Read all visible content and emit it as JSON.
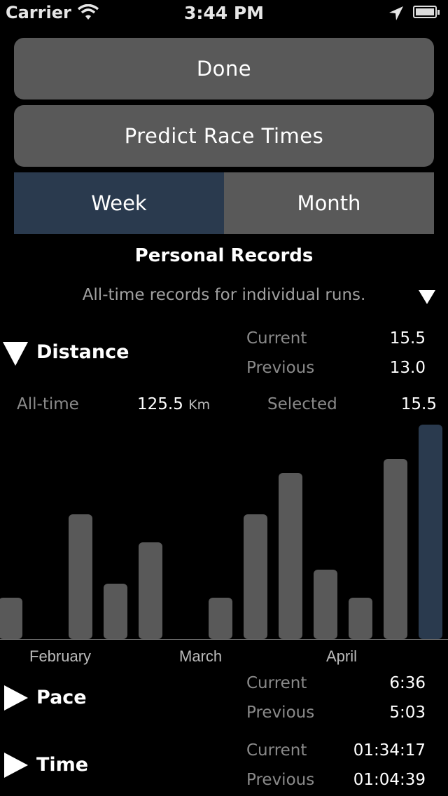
{
  "status_bar": {
    "carrier": "Carrier",
    "time": "3:44 PM"
  },
  "buttons": {
    "done": "Done",
    "predict": "Predict Race Times"
  },
  "segments": {
    "week": "Week",
    "month": "Month",
    "selected": "week"
  },
  "personal_records": {
    "title": "Personal Records",
    "subtitle": "All-time records for individual runs."
  },
  "distance": {
    "title": "Distance",
    "current_label": "Current",
    "current_value": "15.5",
    "previous_label": "Previous",
    "previous_value": "13.0",
    "alltime_label": "All-time",
    "alltime_value": "125.5",
    "alltime_unit": "Km",
    "selected_label": "Selected",
    "selected_value": "15.5"
  },
  "pace": {
    "title": "Pace",
    "current_label": "Current",
    "current_value": "6:36",
    "previous_label": "Previous",
    "previous_value": "5:03"
  },
  "time": {
    "title": "Time",
    "current_label": "Current",
    "current_value": "01:34:17",
    "previous_label": "Previous",
    "previous_value": "01:04:39"
  },
  "colors": {
    "bar": "#595959",
    "bar_selected": "#2a3a4e",
    "accent": "#2a3a4e"
  },
  "chart_data": {
    "type": "bar",
    "values": [
      3,
      0,
      9,
      4,
      7,
      0,
      3,
      9,
      12,
      5,
      3,
      13,
      15.5
    ],
    "selected_index": 12,
    "month_labels": [
      "February",
      "March",
      "April"
    ],
    "ylim": [
      0,
      15.5
    ]
  }
}
